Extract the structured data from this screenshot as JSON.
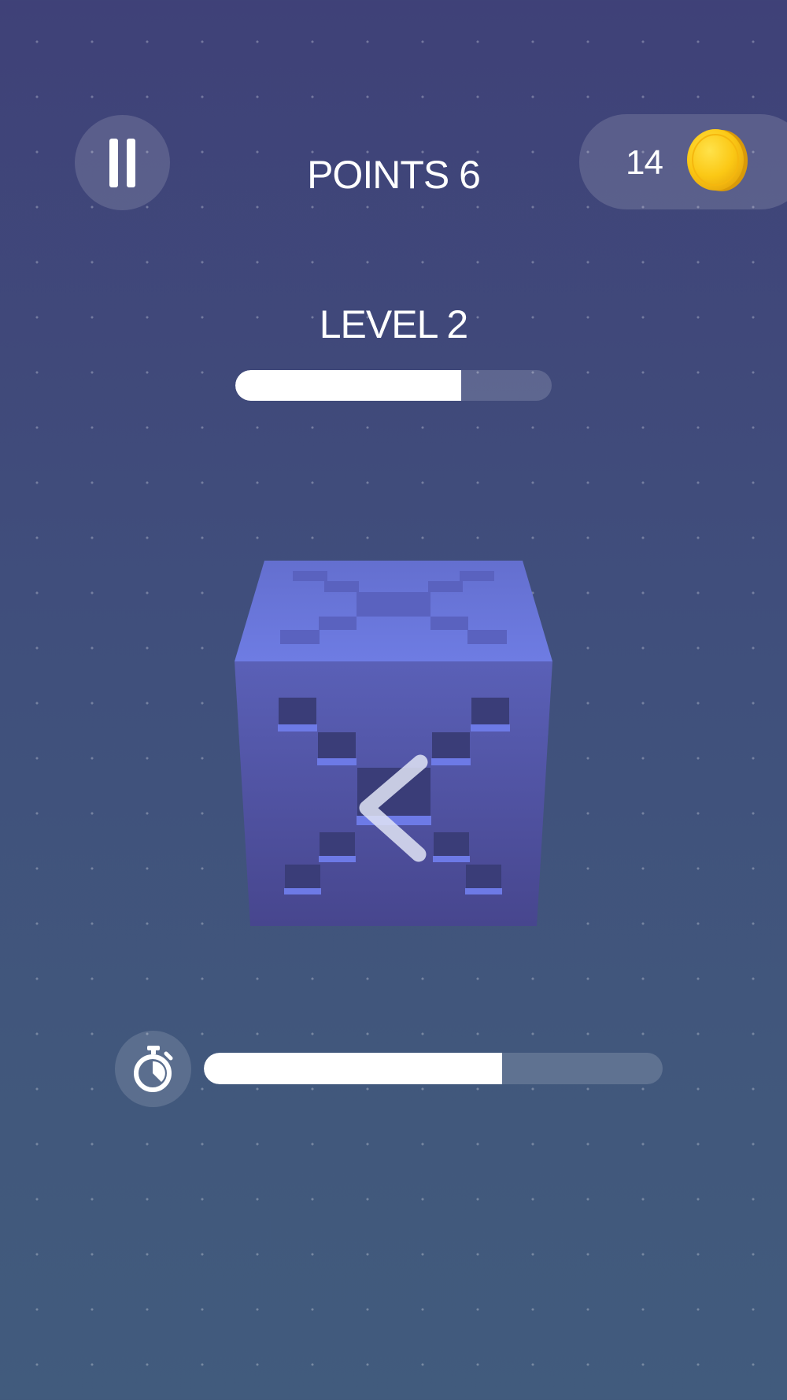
{
  "hud": {
    "points_text": "POINTS 6",
    "coins": "14",
    "pause_icon": "pause-icon",
    "coin_icon": "coin-icon"
  },
  "level": {
    "label": "LEVEL 2",
    "progress": 0.715
  },
  "timer": {
    "icon": "stopwatch-icon",
    "remaining": 0.65
  },
  "cube": {
    "swipe_direction": "left",
    "arrow_icon": "chevron-left-icon"
  },
  "colors": {
    "background_top": "#3f4178",
    "background_bottom": "#415b7d",
    "cube_top": "#6b78d8",
    "cube_front": "#4e55a8",
    "coin": "#f7c613",
    "bar_fill": "#ffffff"
  }
}
